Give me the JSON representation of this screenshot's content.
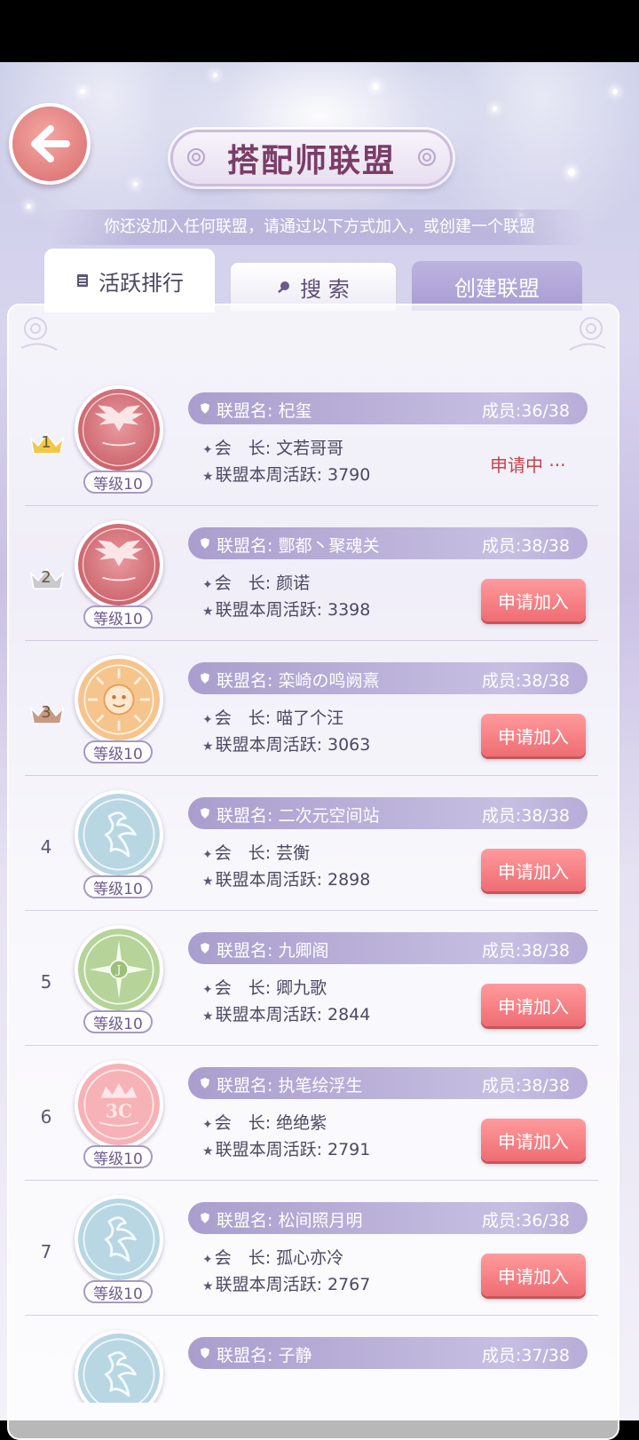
{
  "header": {
    "title": "搭配师联盟",
    "subtitle": "你还没加入任何联盟，请通过以下方式加入，或创建一个联盟",
    "back_icon": "back-arrow-icon"
  },
  "tabs": {
    "ranking": "活跃排行",
    "search": "搜 索",
    "create": "创建联盟"
  },
  "labels": {
    "name_prefix": "联盟名:",
    "members_prefix": "成员:",
    "leader_prefix": "会　长:",
    "activity_prefix": "联盟本周活跃:",
    "apply": "申请加入",
    "pending": "申请中 ···"
  },
  "colors": {
    "accent_pink": "#ee6d73",
    "lavender": "#a99ecd",
    "title_text": "#7a3d68"
  },
  "alliances": [
    {
      "rank": "1",
      "name": "联盟名: 杞玺",
      "members": "成员:36/38",
      "leader": "会　长:  文若哥哥",
      "activity": "联盟本周活跃:  3790",
      "level": "等级10",
      "status": "申请中 ···",
      "emblem": "pink-wing-emblem"
    },
    {
      "rank": "2",
      "name": "联盟名: 酆都丶聚魂关",
      "members": "成员:38/38",
      "leader": "会　长:  颜诺",
      "activity": "联盟本周活跃:  3398",
      "level": "等级10",
      "status": "申请加入",
      "emblem": "pink-wing-emblem"
    },
    {
      "rank": "3",
      "name": "联盟名: 栾崎の鸣阙熹",
      "members": "成员:38/38",
      "leader": "会　长:  喵了个汪",
      "activity": "联盟本周活跃:  3063",
      "level": "等级10",
      "status": "申请加入",
      "emblem": "orange-sun-emblem"
    },
    {
      "rank": "4",
      "name": "联盟名: 二次元空间站",
      "members": "成员:38/38",
      "leader": "会　长:  芸衡",
      "activity": "联盟本周活跃:  2898",
      "level": "等级10",
      "status": "申请加入",
      "emblem": "blue-phoenix-emblem"
    },
    {
      "rank": "5",
      "name": "联盟名: 九卿阁",
      "members": "成员:38/38",
      "leader": "会　长:  卿九歌",
      "activity": "联盟本周活跃:  2844",
      "level": "等级10",
      "status": "申请加入",
      "emblem": "green-compass-emblem"
    },
    {
      "rank": "6",
      "name": "联盟名: 执笔绘浮生",
      "members": "成员:38/38",
      "leader": "会　长:  绝绝紫",
      "activity": "联盟本周活跃:  2791",
      "level": "等级10",
      "status": "申请加入",
      "emblem": "pink-crown-emblem"
    },
    {
      "rank": "7",
      "name": "联盟名: 松间照月明",
      "members": "成员:36/38",
      "leader": "会　长:  孤心亦冷",
      "activity": "联盟本周活跃:  2767",
      "level": "等级10",
      "status": "申请加入",
      "emblem": "blue-phoenix-emblem"
    },
    {
      "rank": "",
      "name": "联盟名: 子静",
      "members": "成员:37/38",
      "leader": "",
      "activity": "",
      "level": "",
      "status": "",
      "emblem": "blue-phoenix-emblem"
    }
  ]
}
